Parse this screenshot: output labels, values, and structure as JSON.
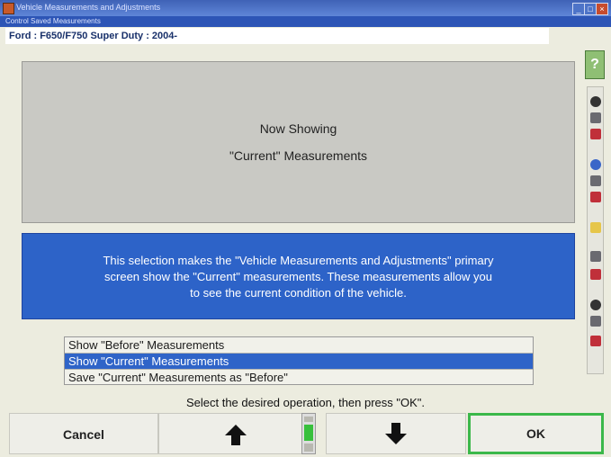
{
  "window": {
    "title": "Vehicle Measurements and Adjustments"
  },
  "subtitle": "Control Saved Measurements",
  "vehicle": "Ford : F650/F750 Super Duty : 2004-",
  "panel": {
    "line1": "Now Showing",
    "line2": "\"Current\" Measurements"
  },
  "description": [
    "This selection makes the \"Vehicle Measurements and Adjustments\" primary",
    "screen show the \"Current\" measurements.  These measurements allow you",
    "to see the current condition of the vehicle."
  ],
  "options": [
    {
      "label": "Show \"Before\" Measurements",
      "selected": false
    },
    {
      "label": "Show \"Current\" Measurements",
      "selected": true
    },
    {
      "label": "Save \"Current\" Measurements as \"Before\"",
      "selected": false
    }
  ],
  "instruction": "Select the desired operation, then press \"OK\".",
  "buttons": {
    "cancel": "Cancel",
    "ok": "OK"
  },
  "help": {
    "glyph": "?"
  },
  "colors": {
    "accent": "#2d63c8",
    "ok_border": "#3bb84a"
  },
  "icons": [
    "up-arrow-icon",
    "down-arrow-icon",
    "help-icon"
  ]
}
